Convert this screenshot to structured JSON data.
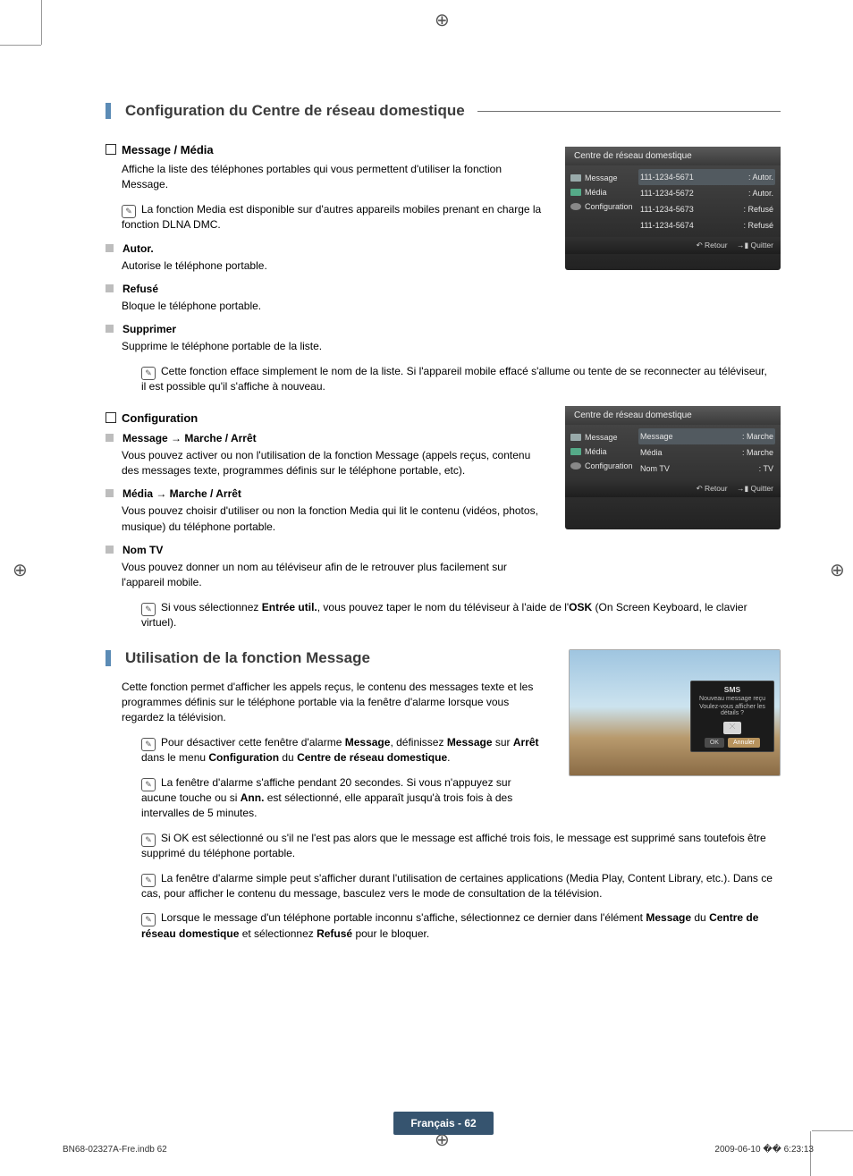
{
  "section1": {
    "title": "Configuration du Centre de réseau domestique",
    "message_media": {
      "heading": "Message / Média",
      "desc": "Affiche la liste des téléphones portables qui vous permettent d'utiliser la fonction Message.",
      "note1": "La fonction Media est disponible sur d'autres appareils mobiles prenant en charge la fonction DLNA DMC.",
      "autor": {
        "h": "Autor.",
        "d": "Autorise le téléphone portable."
      },
      "refuse": {
        "h": "Refusé",
        "d": "Bloque le téléphone portable."
      },
      "supprimer": {
        "h": "Supprimer",
        "d": "Supprime le téléphone portable de la liste.",
        "n": "Cette fonction efface simplement le nom de la liste. Si l'appareil mobile effacé s'allume ou tente de se reconnecter au téléviseur, il est possible qu'il s'affiche à nouveau."
      }
    },
    "config": {
      "heading": "Configuration",
      "msg": {
        "h": "Message → Marche / Arrêt",
        "d": "Vous pouvez activer ou non l'utilisation de la fonction Message (appels reçus, contenu des messages texte, programmes définis sur le téléphone portable, etc)."
      },
      "media": {
        "h": "Média → Marche / Arrêt",
        "d": "Vous pouvez choisir d'utiliser ou non la fonction Media qui lit le contenu (vidéos, photos, musique) du téléphone portable."
      },
      "nomtv": {
        "h": "Nom TV",
        "d": "Vous pouvez donner un nom au téléviseur afin de le retrouver plus facilement sur l'appareil mobile.",
        "n_pre": "Si vous sélectionnez ",
        "n_b1": "Entrée util.",
        "n_mid": ", vous pouvez taper le nom du téléviseur à l'aide de l'",
        "n_b2": "OSK",
        "n_post": " (On Screen Keyboard, le clavier virtuel)."
      }
    }
  },
  "section2": {
    "title": "Utilisation de la fonction Message",
    "intro": "Cette fonction permet d'afficher les appels reçus, le contenu des messages texte et les programmes définis sur le téléphone portable via la fenêtre d'alarme lorsque vous regardez la télévision.",
    "n1_a": "Pour désactiver cette fenêtre d'alarme ",
    "n1_b1": "Message",
    "n1_b": ", définissez ",
    "n1_b2": "Message",
    "n1_c": " sur ",
    "n1_b3": "Arrêt",
    "n1_d": " dans le menu ",
    "n1_b4": "Configuration",
    "n1_e": " du ",
    "n1_b5": "Centre de réseau domestique",
    "n1_f": ".",
    "n2_a": "La fenêtre d'alarme s'affiche pendant 20 secondes. Si vous n'appuyez sur aucune touche ou si ",
    "n2_b1": "Ann.",
    "n2_b": " est sélectionné, elle apparaît jusqu'à trois fois à des intervalles de 5 minutes.",
    "n3": "Si OK est sélectionné ou s'il ne l'est pas alors que le message est affiché trois fois, le message est supprimé sans toutefois être supprimé du téléphone portable.",
    "n4": "La fenêtre d'alarme simple peut s'afficher durant l'utilisation de certaines applications (Media Play, Content Library, etc.). Dans ce cas, pour afficher le contenu du message, basculez vers le mode de consultation de la télévision.",
    "n5_a": "Lorsque le message d'un téléphone portable inconnu s'affiche, sélectionnez ce dernier dans l'élément ",
    "n5_b1": "Message",
    "n5_b": " du ",
    "n5_b2": "Centre de réseau domestique",
    "n5_c": " et sélectionnez ",
    "n5_b3": "Refusé",
    "n5_d": " pour le bloquer."
  },
  "fig1": {
    "title": "Centre de réseau domestique",
    "side": [
      {
        "l": "Message"
      },
      {
        "l": "Média"
      },
      {
        "l": "Configuration"
      }
    ],
    "rows": [
      {
        "k": "111-1234-5671",
        "v": ": Autor."
      },
      {
        "k": "111-1234-5672",
        "v": ": Autor."
      },
      {
        "k": "111-1234-5673",
        "v": ": Refusé"
      },
      {
        "k": "111-1234-5674",
        "v": ": Refusé"
      }
    ],
    "retour": "Retour",
    "quitter": "Quitter"
  },
  "fig2": {
    "title": "Centre de réseau domestique",
    "side": [
      {
        "l": "Message"
      },
      {
        "l": "Média"
      },
      {
        "l": "Configuration"
      }
    ],
    "rows": [
      {
        "k": "Message",
        "v": ": Marche"
      },
      {
        "k": "Média",
        "v": ": Marche"
      },
      {
        "k": "Nom TV",
        "v": ": TV"
      }
    ],
    "retour": "Retour",
    "quitter": "Quitter"
  },
  "fig3": {
    "sms": "SMS",
    "line1": "Nouveau message reçu",
    "line2": "Voulez-vous afficher les détails ?",
    "ok": "OK",
    "ann": "Annuler"
  },
  "footer": {
    "badge": "Français - 62",
    "left": "BN68-02327A-Fre.indb   62",
    "right": "2009-06-10   �� 6:23:13"
  }
}
